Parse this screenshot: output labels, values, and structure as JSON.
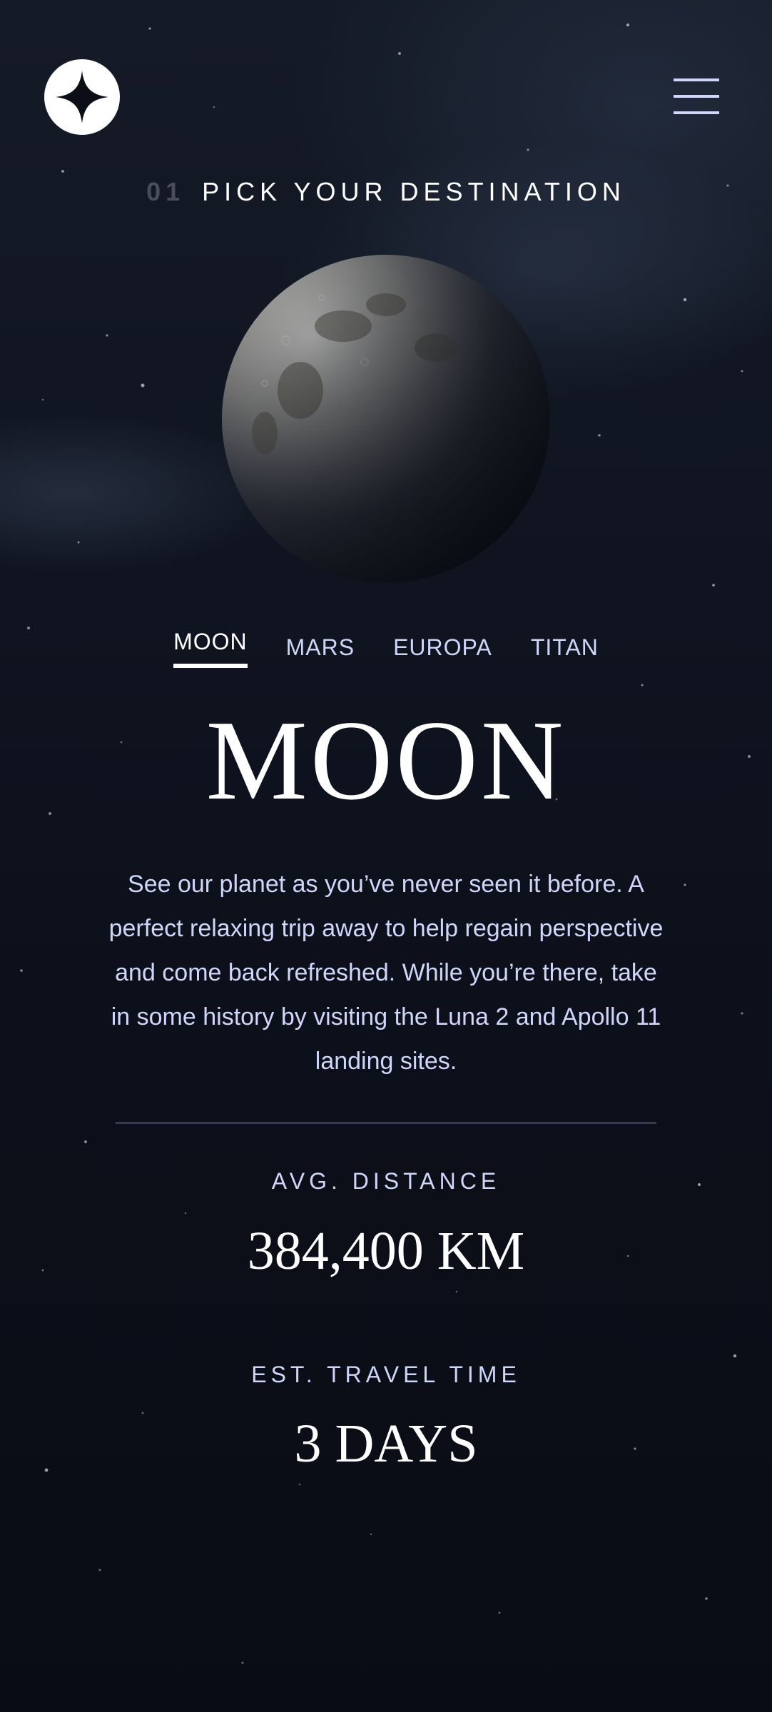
{
  "header": {
    "logo_icon": "star-logo-icon",
    "menu_icon": "hamburger-menu-icon"
  },
  "section": {
    "number": "01",
    "title": "PICK YOUR DESTINATION"
  },
  "tabs": [
    {
      "label": "MOON",
      "active": true
    },
    {
      "label": "MARS",
      "active": false
    },
    {
      "label": "EUROPA",
      "active": false
    },
    {
      "label": "TITAN",
      "active": false
    }
  ],
  "destination": {
    "name": "MOON",
    "description": "See our planet as you’ve never seen it before. A perfect relaxing trip away to help regain perspective and come back refreshed. While you’re there, take in some history by visiting the Luna 2 and Apollo 11 landing sites.",
    "image": "moon-image"
  },
  "stats": {
    "distance_label": "AVG. DISTANCE",
    "distance_value": "384,400 KM",
    "travel_label": "EST. TRAVEL TIME",
    "travel_value": "3 DAYS"
  },
  "colors": {
    "background": "#0b0d17",
    "accent": "#d0d6f9",
    "white": "#ffffff",
    "muted": "#4a4e5c"
  }
}
